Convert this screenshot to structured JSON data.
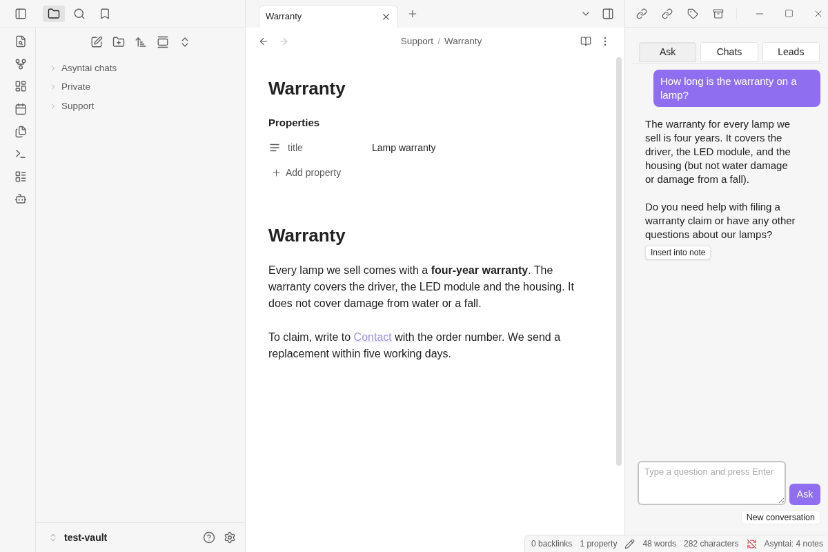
{
  "left_sidebar": {
    "view_tabs": [
      {
        "kind": "files",
        "selected": true
      },
      {
        "kind": "search",
        "selected": false
      },
      {
        "kind": "bookmarks",
        "selected": false
      }
    ]
  },
  "file_tree": [
    {
      "label": "Asyntai chats",
      "expanded": false
    },
    {
      "label": "Private",
      "expanded": false
    },
    {
      "label": "Support",
      "expanded": false
    }
  ],
  "vault": {
    "name": "test-vault"
  },
  "editor_tabs": [
    {
      "title": "Warranty",
      "selected": true
    }
  ],
  "navigation": [
    {
      "kind": "back",
      "disabled": false
    },
    {
      "kind": "forward",
      "disabled": true
    }
  ],
  "breadcrumb": {
    "path": [
      "Support",
      "Warranty"
    ],
    "separator": "/"
  },
  "note": {
    "title": "Warranty",
    "properties_heading": "Properties",
    "properties": [
      {
        "name": "title",
        "value": "Lamp warranty"
      }
    ],
    "add_property": "Add property",
    "heading": "Warranty",
    "paragraphs": [
      {
        "text": "Every lamp we sell comes with a **four-year warranty**. The warranty covers the driver, the LED module and the housing. It does not cover damage from water or a fall."
      },
      {
        "text": "To claim, write to",
        "link": "Contact",
        "text_after": "with the order number. We send a replacement within five working days."
      }
    ]
  },
  "assistant": {
    "tabs": [
      {
        "label": "Ask",
        "selected": true
      },
      {
        "label": "Chats",
        "selected": false
      },
      {
        "label": "Leads",
        "selected": false
      }
    ],
    "messages": [
      {
        "kind": "bubble",
        "text": "How long is the warranty on a lamp?"
      },
      {
        "kind": "plain",
        "paragraphs": [
          "The warranty for every lamp we sell is four years. It covers the driver, the LED module, and the housing (but not water damage or damage from a fall).",
          "Do you need help with filing a warranty claim or have any other questions about our lamps?"
        ],
        "action": "Insert into note"
      }
    ],
    "input": {
      "placeholder": "Type a question and press Enter"
    },
    "send_button": "Ask",
    "new_conversation_button": "New conversation"
  },
  "status_bar": {
    "items": [
      {
        "kind": "text",
        "text": "0 backlinks"
      },
      {
        "kind": "text",
        "text": "1 property"
      },
      {
        "kind": "edit-mode"
      },
      {
        "kind": "text",
        "text": "48 words"
      },
      {
        "kind": "text",
        "text": "282 characters"
      },
      {
        "kind": "sync",
        "on": false
      },
      {
        "kind": "text",
        "text": "Asyntai: 4 notes"
      }
    ]
  }
}
